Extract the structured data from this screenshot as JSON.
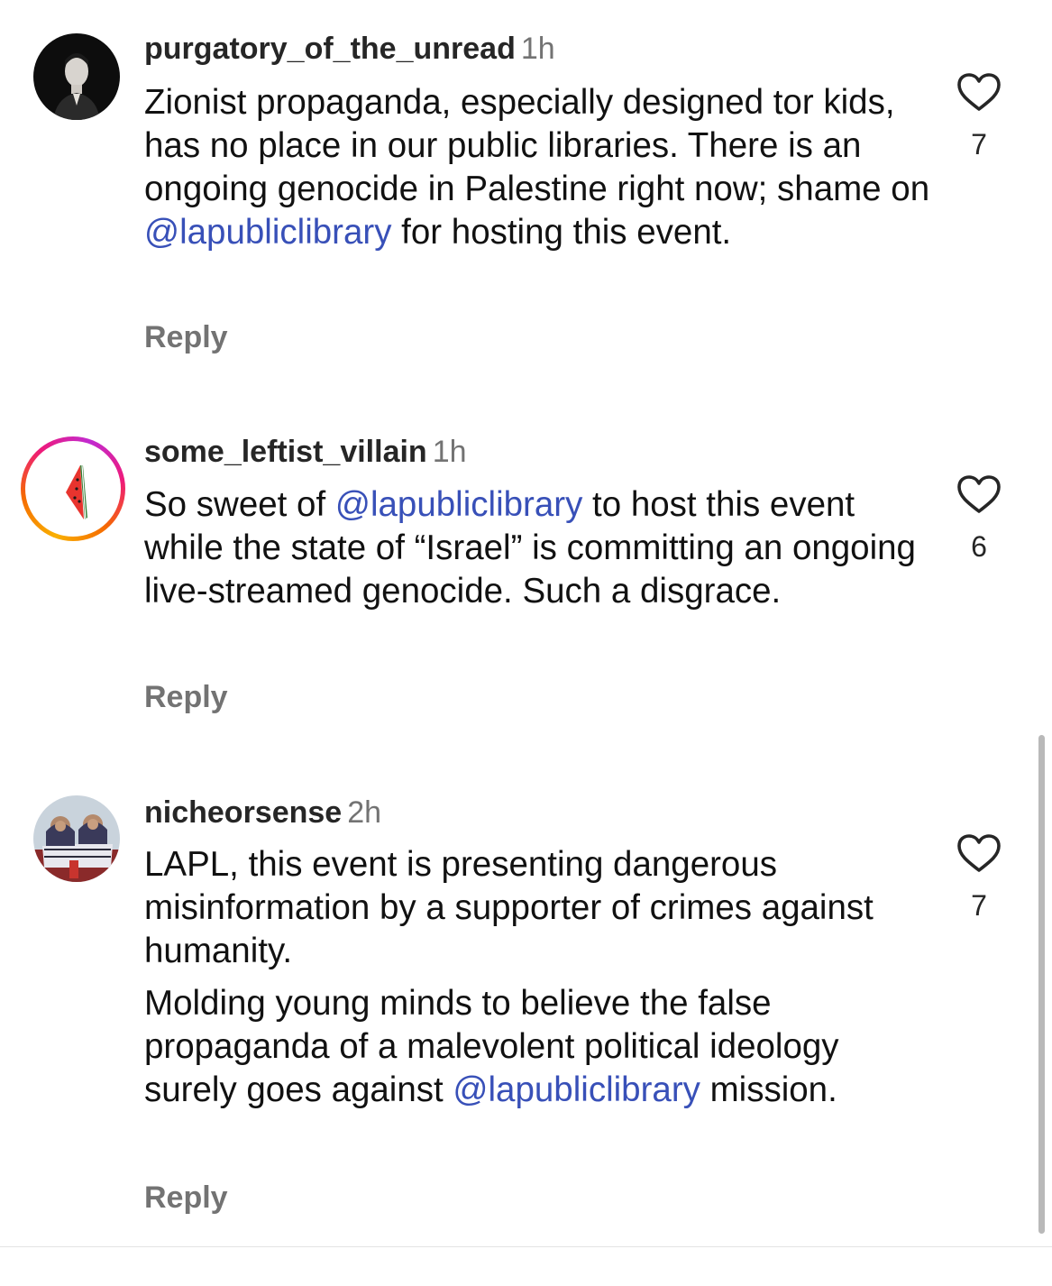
{
  "comments": [
    {
      "username": "purgatory_of_the_unread",
      "time": "1h",
      "paragraphs": [
        [
          {
            "text": "Zionist propaganda, especially designed tor kids, has no place in our public libraries. There is an ongoing genocide in Palestine right now; shame on "
          },
          {
            "text": "@lapubliclibrary",
            "mention": true
          },
          {
            "text": " for hosting this event."
          }
        ]
      ],
      "reply_label": "Reply",
      "likes": "7",
      "avatar_icon": "man-portrait-avatar"
    },
    {
      "username": "some_leftist_villain",
      "time": "1h",
      "paragraphs": [
        [
          {
            "text": "So sweet of "
          },
          {
            "text": "@lapubliclibrary",
            "mention": true
          },
          {
            "text": " to host this event while the state of “Israel” is committing an ongoing live-streamed genocide. Such a disgrace."
          }
        ]
      ],
      "reply_label": "Reply",
      "likes": "6",
      "avatar_icon": "watermelon-avatar"
    },
    {
      "username": "nicheorsense",
      "time": "2h",
      "paragraphs": [
        [
          {
            "text": "LAPL, this event is presenting dangerous misinformation by a supporter of crimes against humanity."
          }
        ],
        [
          {
            "text": "Molding young minds to believe the false propaganda of a malevolent political ideology surely goes against "
          },
          {
            "text": "@lapubliclibrary",
            "mention": true
          },
          {
            "text": " mission."
          }
        ]
      ],
      "reply_label": "Reply",
      "likes": "7",
      "avatar_icon": "group-photo-avatar"
    }
  ],
  "colors": {
    "username": "#262626",
    "meta": "#737373",
    "mention": "#3850b8",
    "text": "#111111"
  },
  "icons": {
    "like": "heart-outline-icon"
  }
}
